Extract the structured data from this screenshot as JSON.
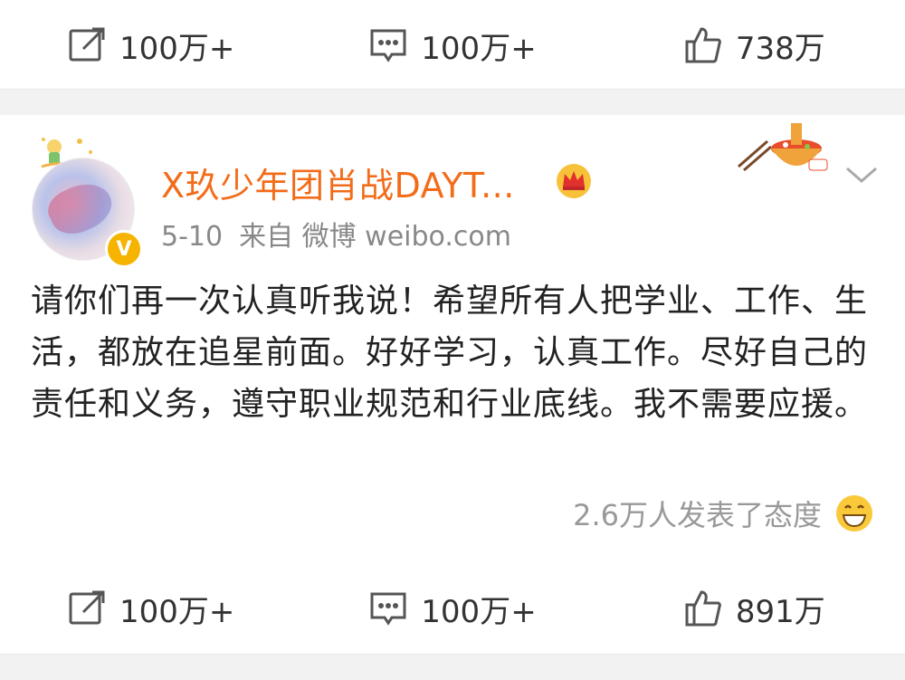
{
  "top_actions": {
    "repost_count": "100万+",
    "comment_count": "100万+",
    "like_count": "738万"
  },
  "post": {
    "username": "X玖少年团肖战DAYT...",
    "date": "5-10",
    "source": "来自 微博 weibo.com",
    "vip_mark": "V",
    "content": "请你们再一次认真听我说！希望所有人把学业、工作、生活，都放在追星前面。好好学习，认真工作。尽好自己的责任和义务，遵守职业规范和行业底线。我不需要应援。",
    "reaction_text": "2.6万人发表了态度"
  },
  "bottom_actions": {
    "repost_count": "100万+",
    "comment_count": "100万+",
    "like_count": "891万"
  },
  "icons": {
    "repost": "repost-icon",
    "comment": "comment-icon",
    "like": "thumbs-up-icon",
    "crown": "crown-icon",
    "hotpot": "hotpot-sticker-icon",
    "chevron": "chevron-down-icon",
    "emoji": "grin-emoji-icon"
  },
  "colors": {
    "username": "#f26c1a",
    "meta": "#888888",
    "vip_badge": "#f6b400",
    "section_gap": "#f2f2f2"
  }
}
